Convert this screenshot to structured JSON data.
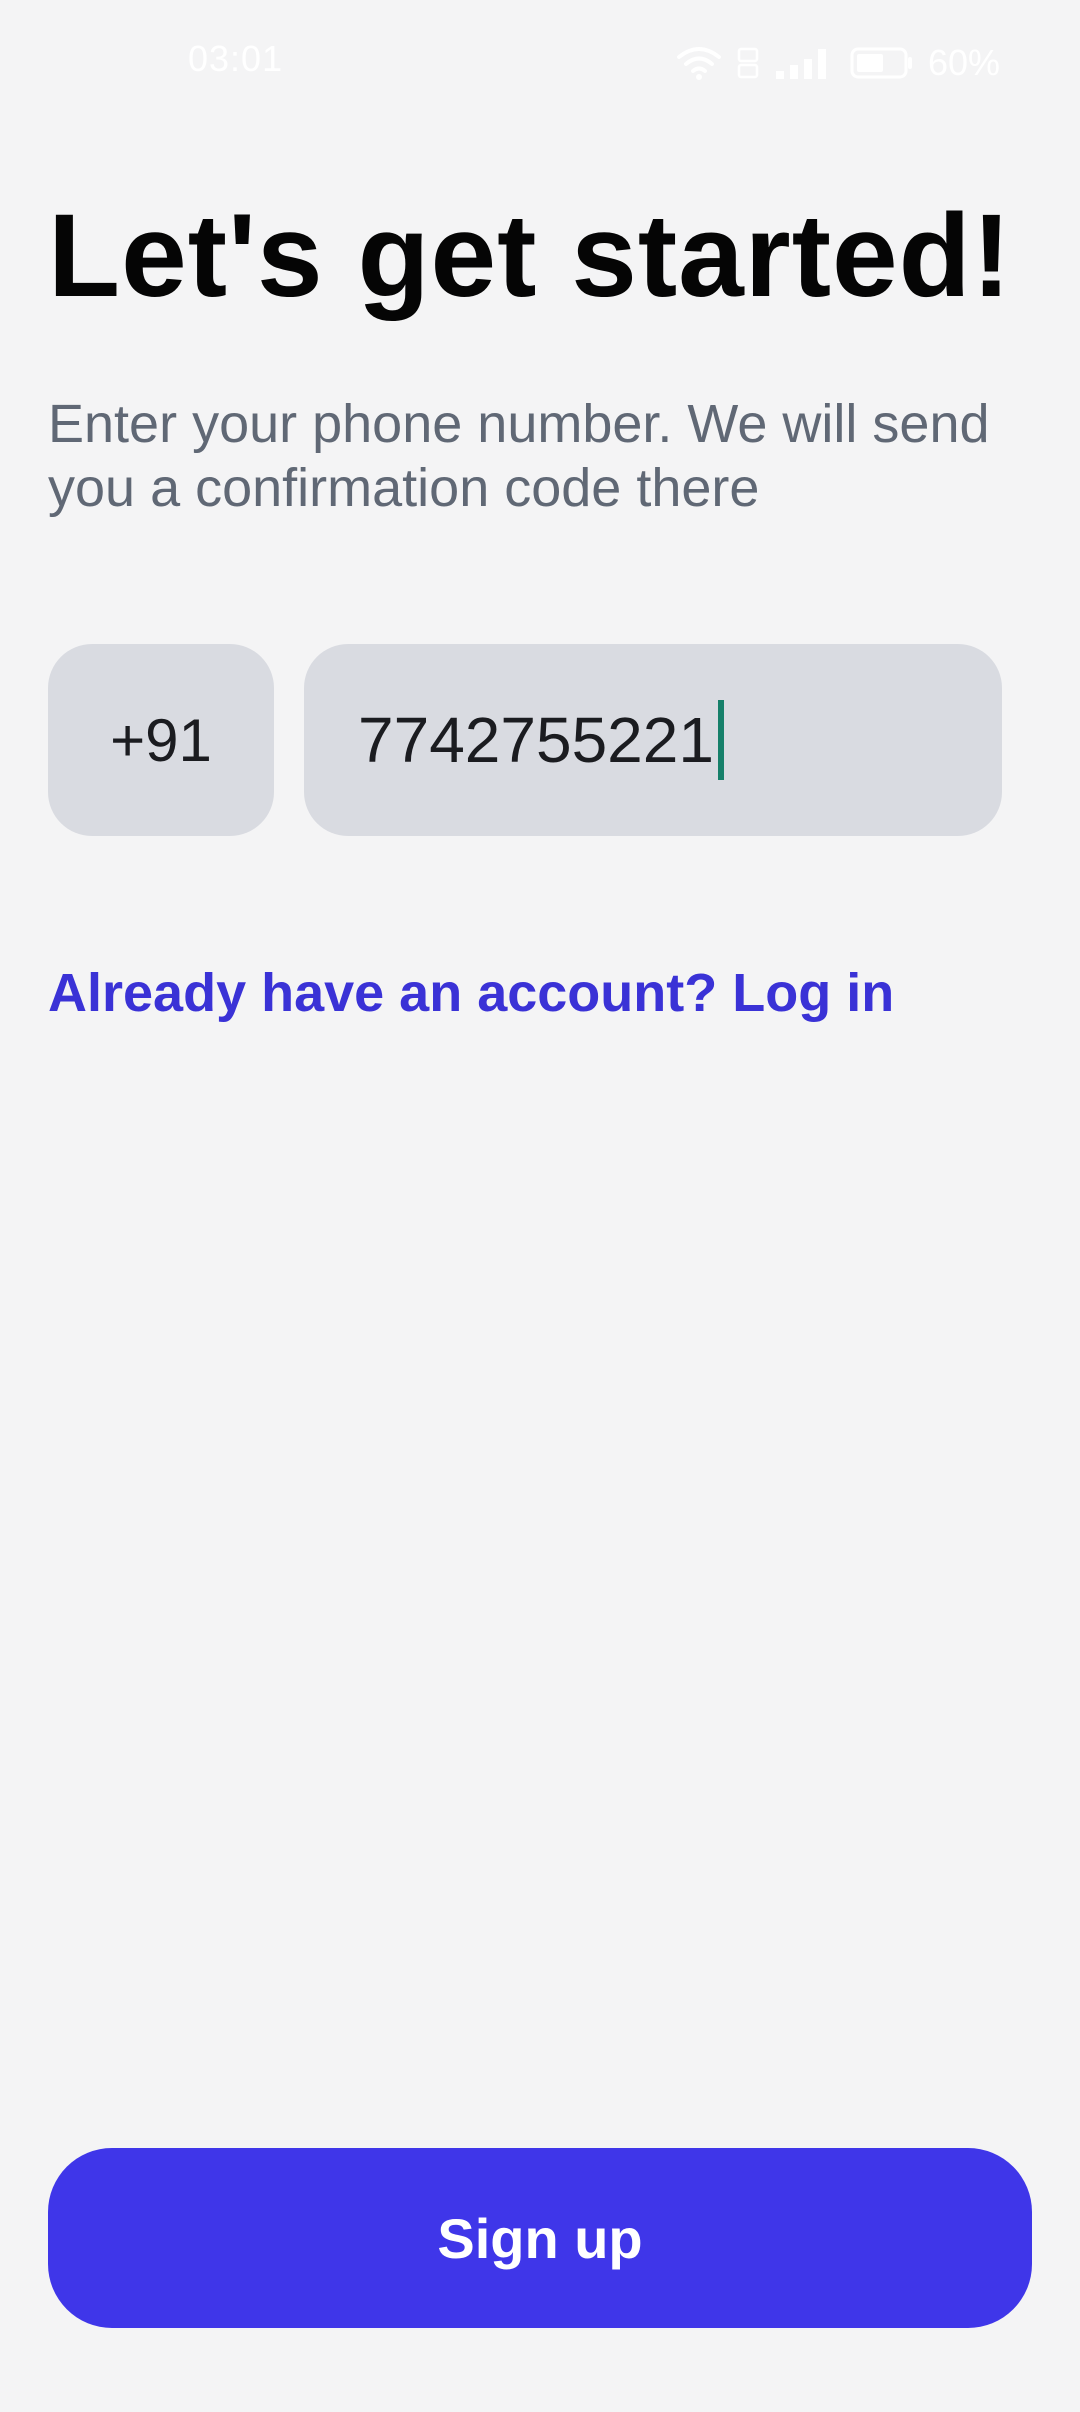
{
  "status_bar": {
    "time": "03:01",
    "battery_percent": "60%",
    "battery_level": 0.6,
    "icons": [
      "wifi-icon",
      "volte-icon",
      "signal-icon",
      "battery-icon"
    ]
  },
  "title": "Let's get started!",
  "subtitle": "Enter your phone number. We will send you a confirmation code there",
  "phone": {
    "country_code": "+91",
    "number": "7742755221"
  },
  "login_link": "Already have an account? Log in",
  "signup_button": "Sign up",
  "colors": {
    "background": "#f4f4f5",
    "accent": "#3f36e9",
    "link": "#3a32d6",
    "input_bg": "#d9dbe1",
    "cursor": "#16806a"
  }
}
